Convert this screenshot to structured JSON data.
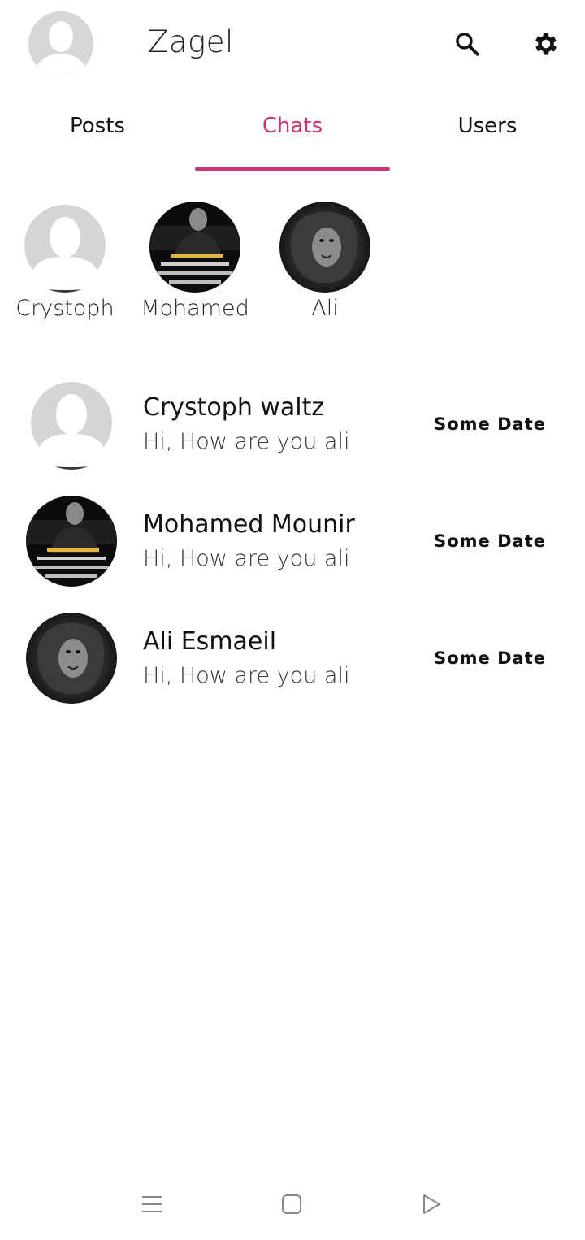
{
  "app": {
    "title": "Zagel"
  },
  "tabs": [
    {
      "label": "Posts",
      "active": false
    },
    {
      "label": "Chats",
      "active": true
    },
    {
      "label": "Users",
      "active": false
    }
  ],
  "accent_color": "#d03373",
  "stories": [
    {
      "name": "Crystoph",
      "avatar": "default-avatar"
    },
    {
      "name": "Mohamed",
      "avatar": "man-photo-avatar"
    },
    {
      "name": "Ali",
      "avatar": "lion-photo-avatar"
    }
  ],
  "chats": [
    {
      "title": "Crystoph waltz",
      "message": "Hi, How are you ali",
      "date": "Some Date",
      "avatar": "default-avatar"
    },
    {
      "title": "Mohamed Mounir",
      "message": "Hi, How are you ali",
      "date": "Some Date",
      "avatar": "man-photo-avatar"
    },
    {
      "title": "Ali Esmaeil",
      "message": "Hi, How are you ali",
      "date": "Some Date",
      "avatar": "lion-photo-avatar"
    }
  ],
  "icons": {
    "search": "search-icon",
    "settings": "gear-icon",
    "nav_menu": "menu-icon",
    "nav_home": "home-square-icon",
    "nav_back": "back-triangle-icon"
  }
}
